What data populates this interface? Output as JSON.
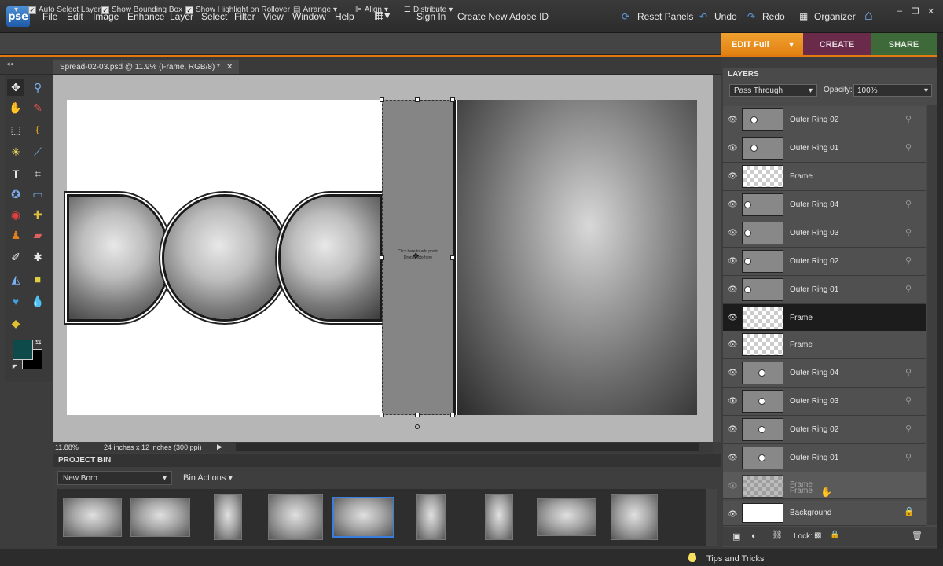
{
  "app": {
    "logo": "pse"
  },
  "menu": [
    "File",
    "Edit",
    "Image",
    "Enhance",
    "Layer",
    "Select",
    "Filter",
    "View",
    "Window",
    "Help"
  ],
  "menu_right": {
    "sign_in": "Sign In",
    "create_id": "Create New Adobe ID",
    "reset_panels": "Reset Panels",
    "undo": "Undo",
    "redo": "Redo",
    "organizer": "Organizer"
  },
  "options": {
    "auto_select": "Auto Select Layer",
    "bounding_box": "Show Bounding Box",
    "highlight": "Show Highlight on Rollover",
    "arrange": "Arrange",
    "align": "Align",
    "distribute": "Distribute"
  },
  "modes": {
    "edit": "EDIT Full",
    "create": "CREATE",
    "share": "SHARE"
  },
  "document_tab": "Spread-02-03.psd @ 11.9% (Frame, RGB/8) *",
  "frame_placeholder": {
    "line1": "Click here to add photo",
    "line2": "Drop photo here"
  },
  "status": {
    "zoom": "11.88%",
    "doc_size": "24 inches x 12 inches (300 ppi)"
  },
  "project_bin": {
    "title": "PROJECT BIN",
    "album": "New Born",
    "actions": "Bin Actions"
  },
  "layers_panel": {
    "title": "LAYERS",
    "blend_mode": "Pass Through",
    "opacity_label": "Opacity:",
    "opacity_value": "100%",
    "layers": [
      {
        "name": "Outer Ring 02",
        "thumb": "ring"
      },
      {
        "name": "Outer Ring 01",
        "thumb": "ring"
      },
      {
        "name": "Frame",
        "thumb": "checker"
      },
      {
        "name": "Outer Ring 04",
        "thumb": "ring"
      },
      {
        "name": "Outer Ring 03",
        "thumb": "ring"
      },
      {
        "name": "Outer Ring 02",
        "thumb": "ring"
      },
      {
        "name": "Outer Ring 01",
        "thumb": "ring"
      },
      {
        "name": "Frame",
        "thumb": "checker",
        "selected": true
      },
      {
        "name": "Frame",
        "thumb": "checker"
      },
      {
        "name": "Outer Ring 04",
        "thumb": "ring"
      },
      {
        "name": "Outer Ring 03",
        "thumb": "ring"
      },
      {
        "name": "Outer Ring 02",
        "thumb": "ring"
      },
      {
        "name": "Outer Ring 01",
        "thumb": "ring"
      }
    ],
    "dragging_labels": [
      "Frame",
      "Frame"
    ],
    "background": "Background",
    "lock_label": "Lock:"
  },
  "tips": "Tips and Tricks",
  "colors": {
    "accent_orange": "#e07a10",
    "create_purple": "#6a2a4a",
    "share_green": "#3d6a38",
    "fg_swatch": "#0e4a4a"
  }
}
